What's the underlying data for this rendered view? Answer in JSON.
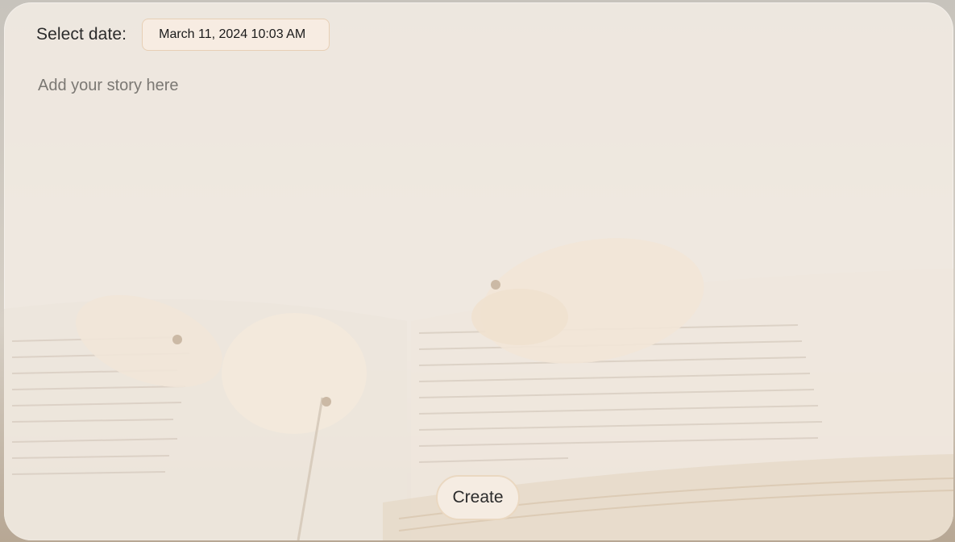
{
  "form": {
    "date_label": "Select date:",
    "date_value": "March 11, 2024 10:03 AM",
    "story_placeholder": "Add your story here",
    "story_value": "",
    "create_label": "Create"
  },
  "colors": {
    "card_background": "#f3ece4",
    "date_input_border": "#e7cfb5",
    "date_input_background": "#f7ece2",
    "button_border": "#ead8c1",
    "button_background": "#f5ece2",
    "placeholder_text": "#7b7873"
  },
  "background": {
    "description_icon": "book-with-petals-image"
  }
}
